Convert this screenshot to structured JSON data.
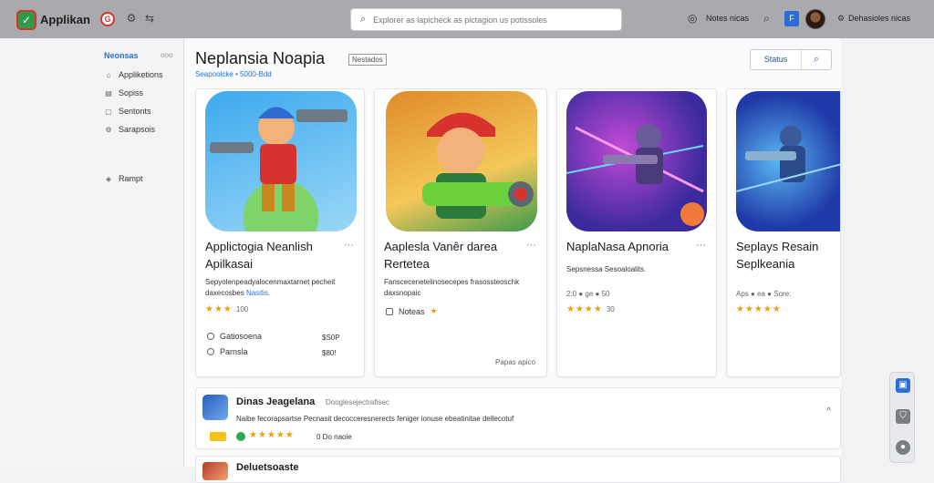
{
  "topbar": {
    "app_name": "Applikan",
    "red_icon_label": "G",
    "search_placeholder": "Explorer as lapicheck as pictagion us potissoles",
    "status_label": "Notes nicas",
    "user_label": "Dehasioles nicas"
  },
  "sidebar": {
    "heading": "Neonsas",
    "heading_extra": "ooo",
    "items": [
      {
        "label": "Appliketions",
        "icon": "grid-icon"
      },
      {
        "label": "Sopiss",
        "icon": "list-icon"
      },
      {
        "label": "Sentonts",
        "icon": "doc-icon"
      },
      {
        "label": "Sarapsois",
        "icon": "gear-icon"
      },
      {
        "label": "Rampt",
        "icon": "tag-icon"
      }
    ]
  },
  "main": {
    "title": "Neplansia Noapia",
    "title_badge": "Nestados",
    "subtitle": "Seapoolcke • 5000-Bdd",
    "status_button": "Status",
    "cards": [
      {
        "title": "Applictogia Neanlish Apilkasai",
        "more": "···",
        "desc_line1": "Sepyolenpeadyalocenmaxtarnet pecheit",
        "desc_line2": "daxecosbes",
        "desc_link": "Nasitis.",
        "rating_stars": "★★★",
        "rating_text": "100",
        "option1_label": "Gatiosoena",
        "option1_price": "$S0P",
        "option2_label": "Parnsla",
        "option2_price": "$80!",
        "art_colors": [
          "#3da9ee",
          "#7fd36a"
        ]
      },
      {
        "title": "Aaplesla Vanêr darea Rertetea",
        "more": "···",
        "desc_line1": "Fanscecenetelinosecepes frasossteoschk",
        "desc_line2": "daxsnopaic",
        "rating_prefix": "Noteas",
        "footer": "Papas apico",
        "art_colors": [
          "#e08a2a",
          "#3a9a4a"
        ]
      },
      {
        "title": "NaplaNasa Apnoria",
        "more": "···",
        "desc_line1": "Sepsnessa Sesoaloalits.",
        "meta": "2:0 ● ge ● 50",
        "rating_stars": "★★★★",
        "rating_text": "30",
        "art_colors": [
          "#3b2a9e",
          "#c24ad6"
        ]
      },
      {
        "title": "Seplays Resain Seplkeania",
        "more": "",
        "desc_line1": "",
        "meta": "Aps ● ea ● Sore:",
        "rating_stars": "★★★★★",
        "art_colors": [
          "#1f3aa8",
          "#5ab8f2"
        ]
      }
    ],
    "row": {
      "title": "Dinas Jeagelana",
      "meta": "Dooglesejectrafisec",
      "desc": "Naibe fecorapsartse Pecnasit decocceresnerects feniger ionuse ebeatinitae dellecotuf",
      "stars": "★★★★★",
      "price": "0 Do naoie",
      "chevron": "^"
    },
    "row2": {
      "title": "Deluetsoaste"
    }
  },
  "colors": {
    "accent": "#2b6fd6",
    "brand_green": "#2f9a4a",
    "brand_red": "#d8322f",
    "star": "#e8a10f",
    "topbar": "#a9aaad"
  }
}
